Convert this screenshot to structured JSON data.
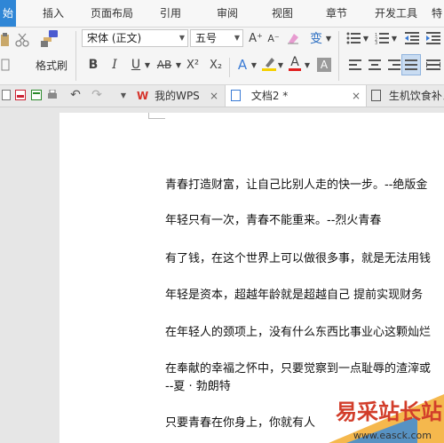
{
  "menu": {
    "tabs": [
      "始",
      "插入",
      "页面布局",
      "引用",
      "审阅",
      "视图",
      "章节",
      "开发工具",
      "特"
    ]
  },
  "ribbon": {
    "format_painter_label": "格式刷",
    "font_name": "宋体 (正文)",
    "font_size": "五号",
    "grow_font": "A⁺",
    "shrink_font": "A⁻",
    "phonetic": "变",
    "bold": "B",
    "italic": "I",
    "underline": "U",
    "strikethrough": "AB",
    "superscript": "X²",
    "subscript": "X₂",
    "text_effect": "A",
    "highlight": "A",
    "font_color": "A",
    "char_shading": "A"
  },
  "tabbar": {
    "tabs": [
      {
        "label": "我的WPS",
        "close": "×"
      },
      {
        "label": "文档2 *",
        "close": "×"
      },
      {
        "label": "生机饮食补え"
      }
    ]
  },
  "document": {
    "lines": [
      "青春打造财富，让自己比别人走的快一步。--绝版金",
      "年轻只有一次，青春不能重来。--烈火青春",
      "有了钱，在这个世界上可以做很多事，就是无法用钱",
      "年轻是资本，超越年龄就是超越自己  提前实现财务",
      "在年轻人的颈项上，没有什么东西比事业心这颗灿烂",
      "在奉献的幸福之怀中，只要觉察到一点耻辱的渣滓或",
      "--夏 · 勃朗特",
      "只要青春在你身上，你就有人"
    ]
  },
  "watermark": {
    "title": "易采站长站",
    "url": "www.easck.com"
  },
  "colors": {
    "accent": "#2f86d6",
    "font_color_bar": "#e02020",
    "highlight_bar": "#f5d000"
  }
}
